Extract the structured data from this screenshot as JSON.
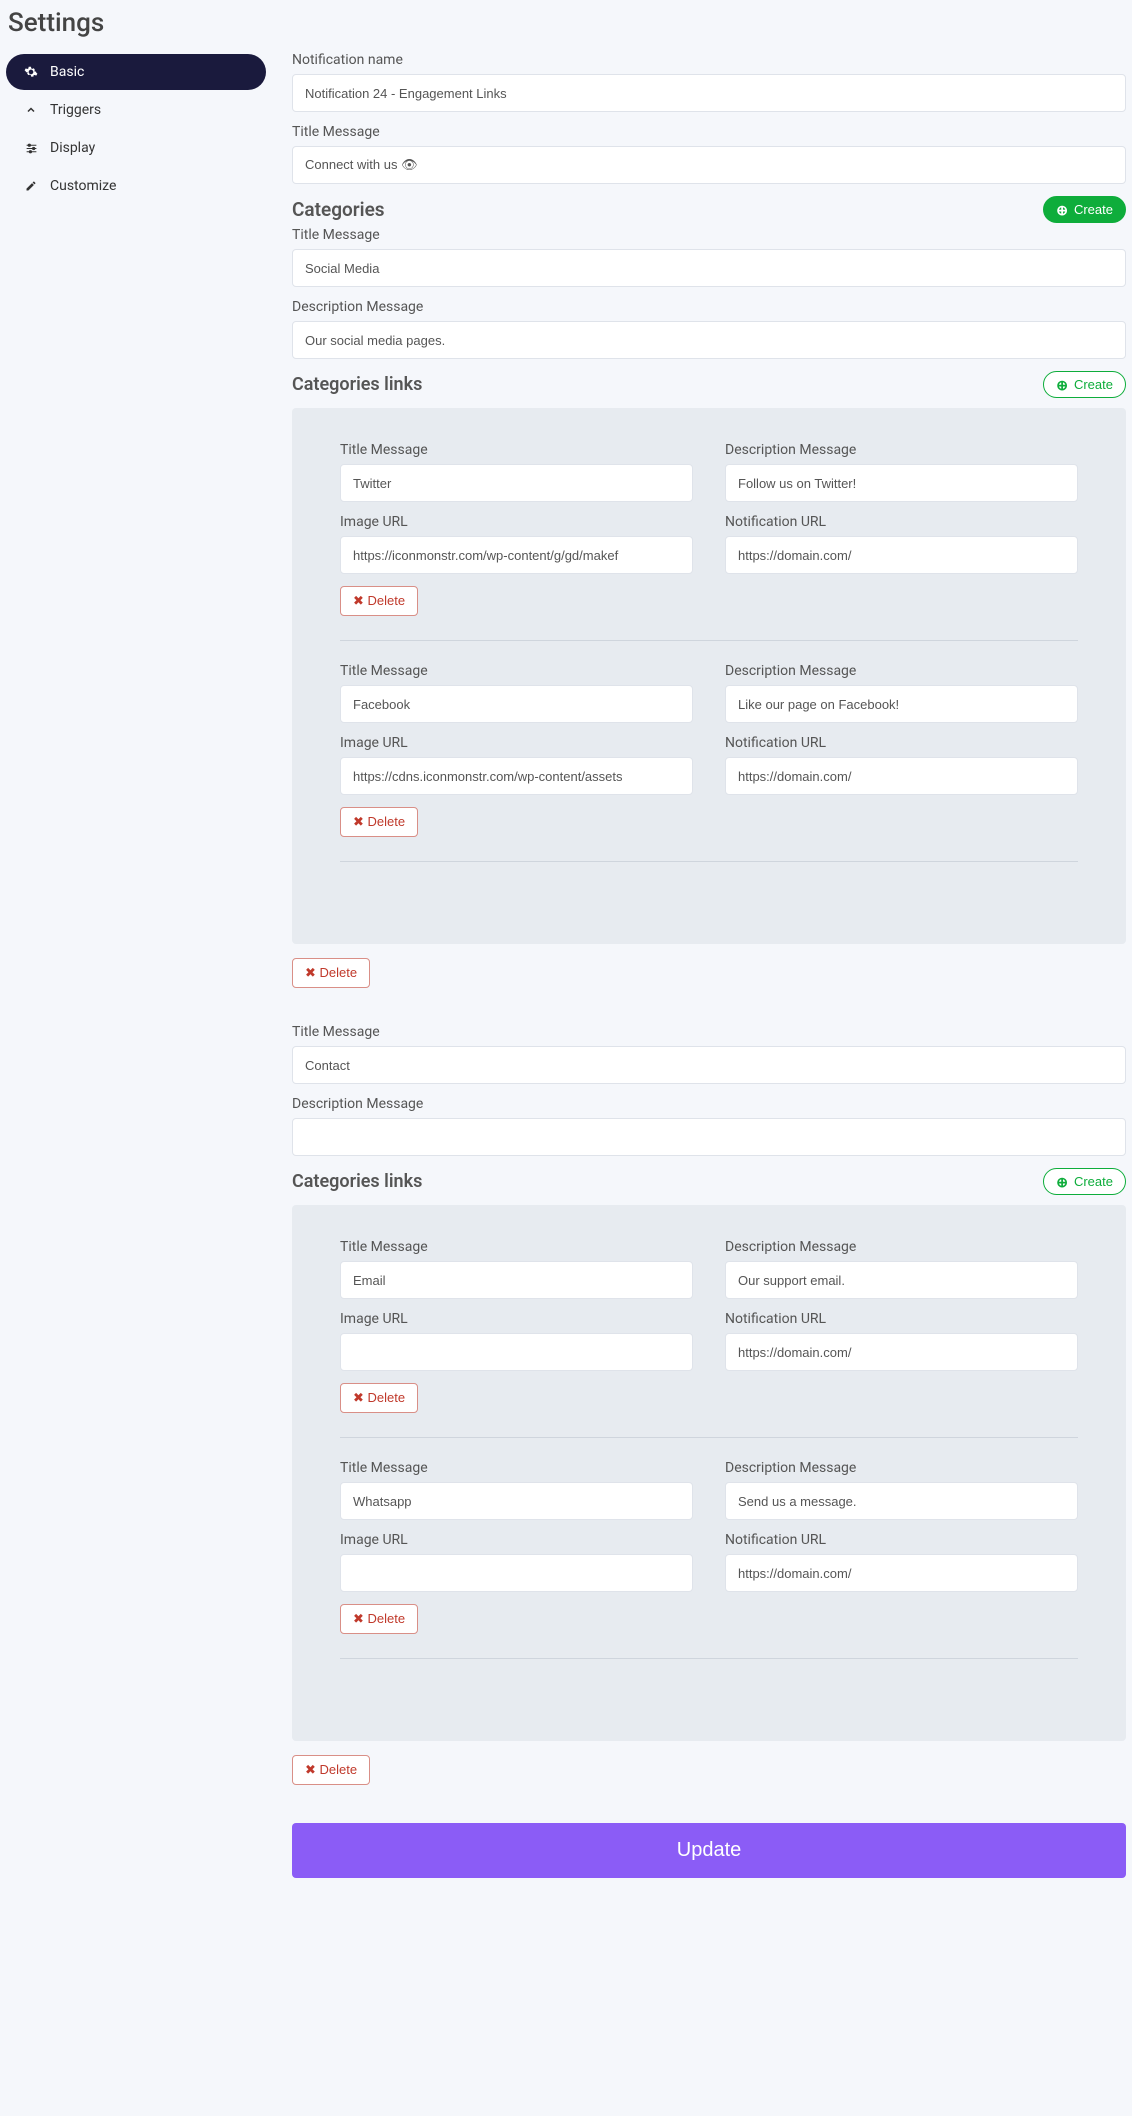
{
  "page_title": "Settings",
  "nav": [
    {
      "icon": "gear",
      "label": "Basic",
      "active": true
    },
    {
      "icon": "chev",
      "label": "Triggers",
      "active": false
    },
    {
      "icon": "lines",
      "label": "Display",
      "active": false
    },
    {
      "icon": "pencil",
      "label": "Customize",
      "active": false
    }
  ],
  "labels": {
    "notification_name": "Notification name",
    "title_message": "Title Message",
    "description_message": "Description Message",
    "image_url": "Image URL",
    "notification_url": "Notification URL",
    "categories": "Categories",
    "categories_links": "Categories links",
    "create": "Create",
    "delete": "Delete",
    "update": "Update"
  },
  "form": {
    "notification_name": "Notification 24 - Engagement Links",
    "title_message": "Connect with us 👁"
  },
  "categories": [
    {
      "title": "Social Media",
      "description": "Our social media pages.",
      "links": [
        {
          "title": "Twitter",
          "description": "Follow us on Twitter!",
          "image": "https://iconmonstr.com/wp-content/g/gd/makef",
          "url": "https://domain.com/"
        },
        {
          "title": "Facebook",
          "description": "Like our page on Facebook!",
          "image": "https://cdns.iconmonstr.com/wp-content/assets",
          "url": "https://domain.com/"
        }
      ]
    },
    {
      "title": "Contact",
      "description": "",
      "links": [
        {
          "title": "Email",
          "description": "Our support email.",
          "image": "",
          "url": "https://domain.com/"
        },
        {
          "title": "Whatsapp",
          "description": "Send us a message.",
          "image": "",
          "url": "https://domain.com/"
        }
      ]
    }
  ]
}
